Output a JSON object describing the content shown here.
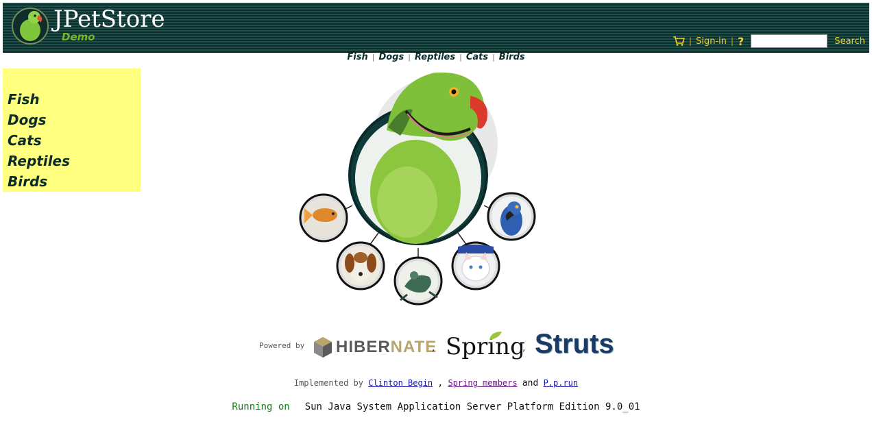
{
  "header": {
    "logo_title": "JPetStore",
    "logo_subtitle": "Demo",
    "sign_in": "Sign-in",
    "help": "?",
    "search_value": "",
    "search_button": "Search",
    "cart_icon": "cart-icon",
    "separator": "|"
  },
  "topnav": {
    "items": [
      "Fish",
      "Dogs",
      "Reptiles",
      "Cats",
      "Birds"
    ],
    "separator": "|"
  },
  "sidebar": {
    "items": [
      "Fish",
      "Dogs",
      "Cats",
      "Reptiles",
      "Birds"
    ]
  },
  "footer": {
    "powered_by": "Powered by",
    "hibernate_a": "HIBER",
    "hibernate_b": "NATE",
    "spring": "Spring",
    "struts": "Struts",
    "sep": ",",
    "implemented_by": "Implemented by",
    "impl_link1": "Clinton Begin",
    "impl_sep": ",",
    "impl_link2": "Spring members",
    "impl_and": "and",
    "impl_link3": "P.p.run",
    "running_on": "Running on",
    "server": "Sun Java System Application Server Platform Edition 9.0_01"
  },
  "colors": {
    "header_bg": "#163f3b",
    "sidebar_bg": "#ffff80",
    "link_yellow": "#f3d21c",
    "brand_green": "#79b526"
  }
}
